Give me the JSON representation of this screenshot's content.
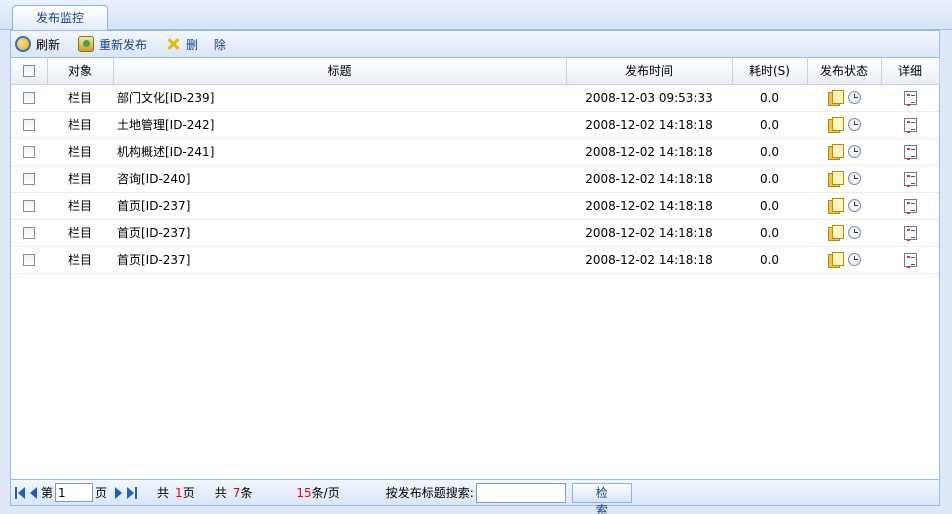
{
  "tab": {
    "label": "发布监控"
  },
  "toolbar": {
    "refresh_label": "刷新",
    "republish_label": "重新发布",
    "delete_label": "删 除"
  },
  "table": {
    "headers": {
      "object": "对象",
      "title": "标题",
      "publish_time": "发布时间",
      "duration": "耗时(S)",
      "status": "发布状态",
      "detail": "详细"
    },
    "rows": [
      {
        "object": "栏目",
        "title": "部门文化[ID-239]",
        "time": "2008-12-03 09:53:33",
        "duration": "0.0"
      },
      {
        "object": "栏目",
        "title": "土地管理[ID-242]",
        "time": "2008-12-02 14:18:18",
        "duration": "0.0"
      },
      {
        "object": "栏目",
        "title": "机构概述[ID-241]",
        "time": "2008-12-02 14:18:18",
        "duration": "0.0"
      },
      {
        "object": "栏目",
        "title": "咨询[ID-240]",
        "time": "2008-12-02 14:18:18",
        "duration": "0.0"
      },
      {
        "object": "栏目",
        "title": "首页[ID-237]",
        "time": "2008-12-02 14:18:18",
        "duration": "0.0"
      },
      {
        "object": "栏目",
        "title": "首页[ID-237]",
        "time": "2008-12-02 14:18:18",
        "duration": "0.0"
      },
      {
        "object": "栏目",
        "title": "首页[ID-237]",
        "time": "2008-12-02 14:18:18",
        "duration": "0.0"
      }
    ]
  },
  "pager": {
    "page_prefix": "第",
    "page_value": "1",
    "page_suffix": "页",
    "total_pages_prefix": "共",
    "total_pages": "1",
    "total_pages_suffix": "页",
    "total_items_prefix": "共",
    "total_items": "7",
    "total_items_suffix": "条",
    "page_size": "15",
    "page_size_suffix": "条/页",
    "search_label": "按发布标题搜索:",
    "search_value": "",
    "search_button": "检 索"
  }
}
